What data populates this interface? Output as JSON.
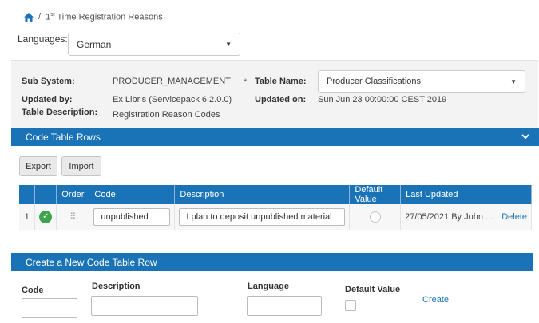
{
  "breadcrumb": {
    "separator": "/",
    "prefix": "1",
    "sup": "st",
    "title_rest": " Time Registration Reasons"
  },
  "language": {
    "label": "Languages:",
    "selected": "German"
  },
  "info": {
    "sub_system_label": "Sub System:",
    "sub_system_value": "PRODUCER_MANAGEMENT",
    "updated_by_label": "Updated by:",
    "updated_by_value": "Ex Libris (Servicepack 6.2.0.0)",
    "table_description_label": "Table Description:",
    "table_description_value": "Registration Reason Codes",
    "required_mark": "*",
    "table_name_label": "Table Name:",
    "table_name_value": "Producer Classifications",
    "updated_on_label": "Updated on:",
    "updated_on_value": "Sun Jun 23 00:00:00 CEST 2019"
  },
  "code_rows_section": {
    "title": "Code Table Rows",
    "export_label": "Export",
    "import_label": "Import",
    "columns": [
      "",
      "",
      "Order",
      "Code",
      "Description",
      "Default Value",
      "Last Updated",
      ""
    ],
    "rows": [
      {
        "index": "1",
        "code": "unpublished",
        "description": "I plan to deposit unpublished material",
        "last_updated": "27/05/2021  By John ...",
        "action": "Delete"
      }
    ]
  },
  "create_section": {
    "title": "Create a New Code Table Row",
    "code_label": "Code",
    "description_label": "Description",
    "language_label": "Language",
    "default_value_label": "Default Value",
    "create_label": "Create"
  },
  "colors": {
    "accent": "#1a73b6",
    "success": "#3fa34d",
    "panel": "#f3f3f3"
  }
}
